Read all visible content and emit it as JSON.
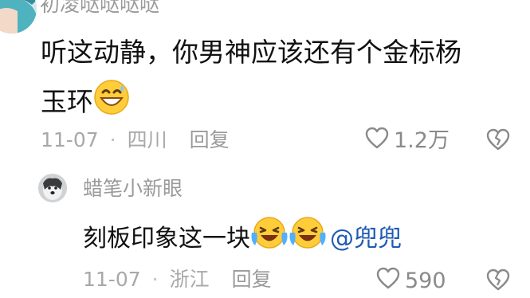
{
  "comment": {
    "username": "初凌哒哒哒哒",
    "text_line1": "听这动静，你男神应该还有个金标杨",
    "text_line2": "玉环",
    "emoji": "grinning-sweat-emoji",
    "date": "11-07",
    "separator": "·",
    "location": "四川",
    "reply_label": "回复",
    "like_count": "1.2万"
  },
  "reply": {
    "username": "蜡笔小新眼",
    "text": "刻板印象这一块",
    "emojis": [
      "laughing-crying-emoji",
      "laughing-crying-emoji"
    ],
    "mention": "@兜兜",
    "date": "11-07",
    "separator": "·",
    "location": "浙江",
    "reply_label": "回复",
    "like_count": "590"
  }
}
